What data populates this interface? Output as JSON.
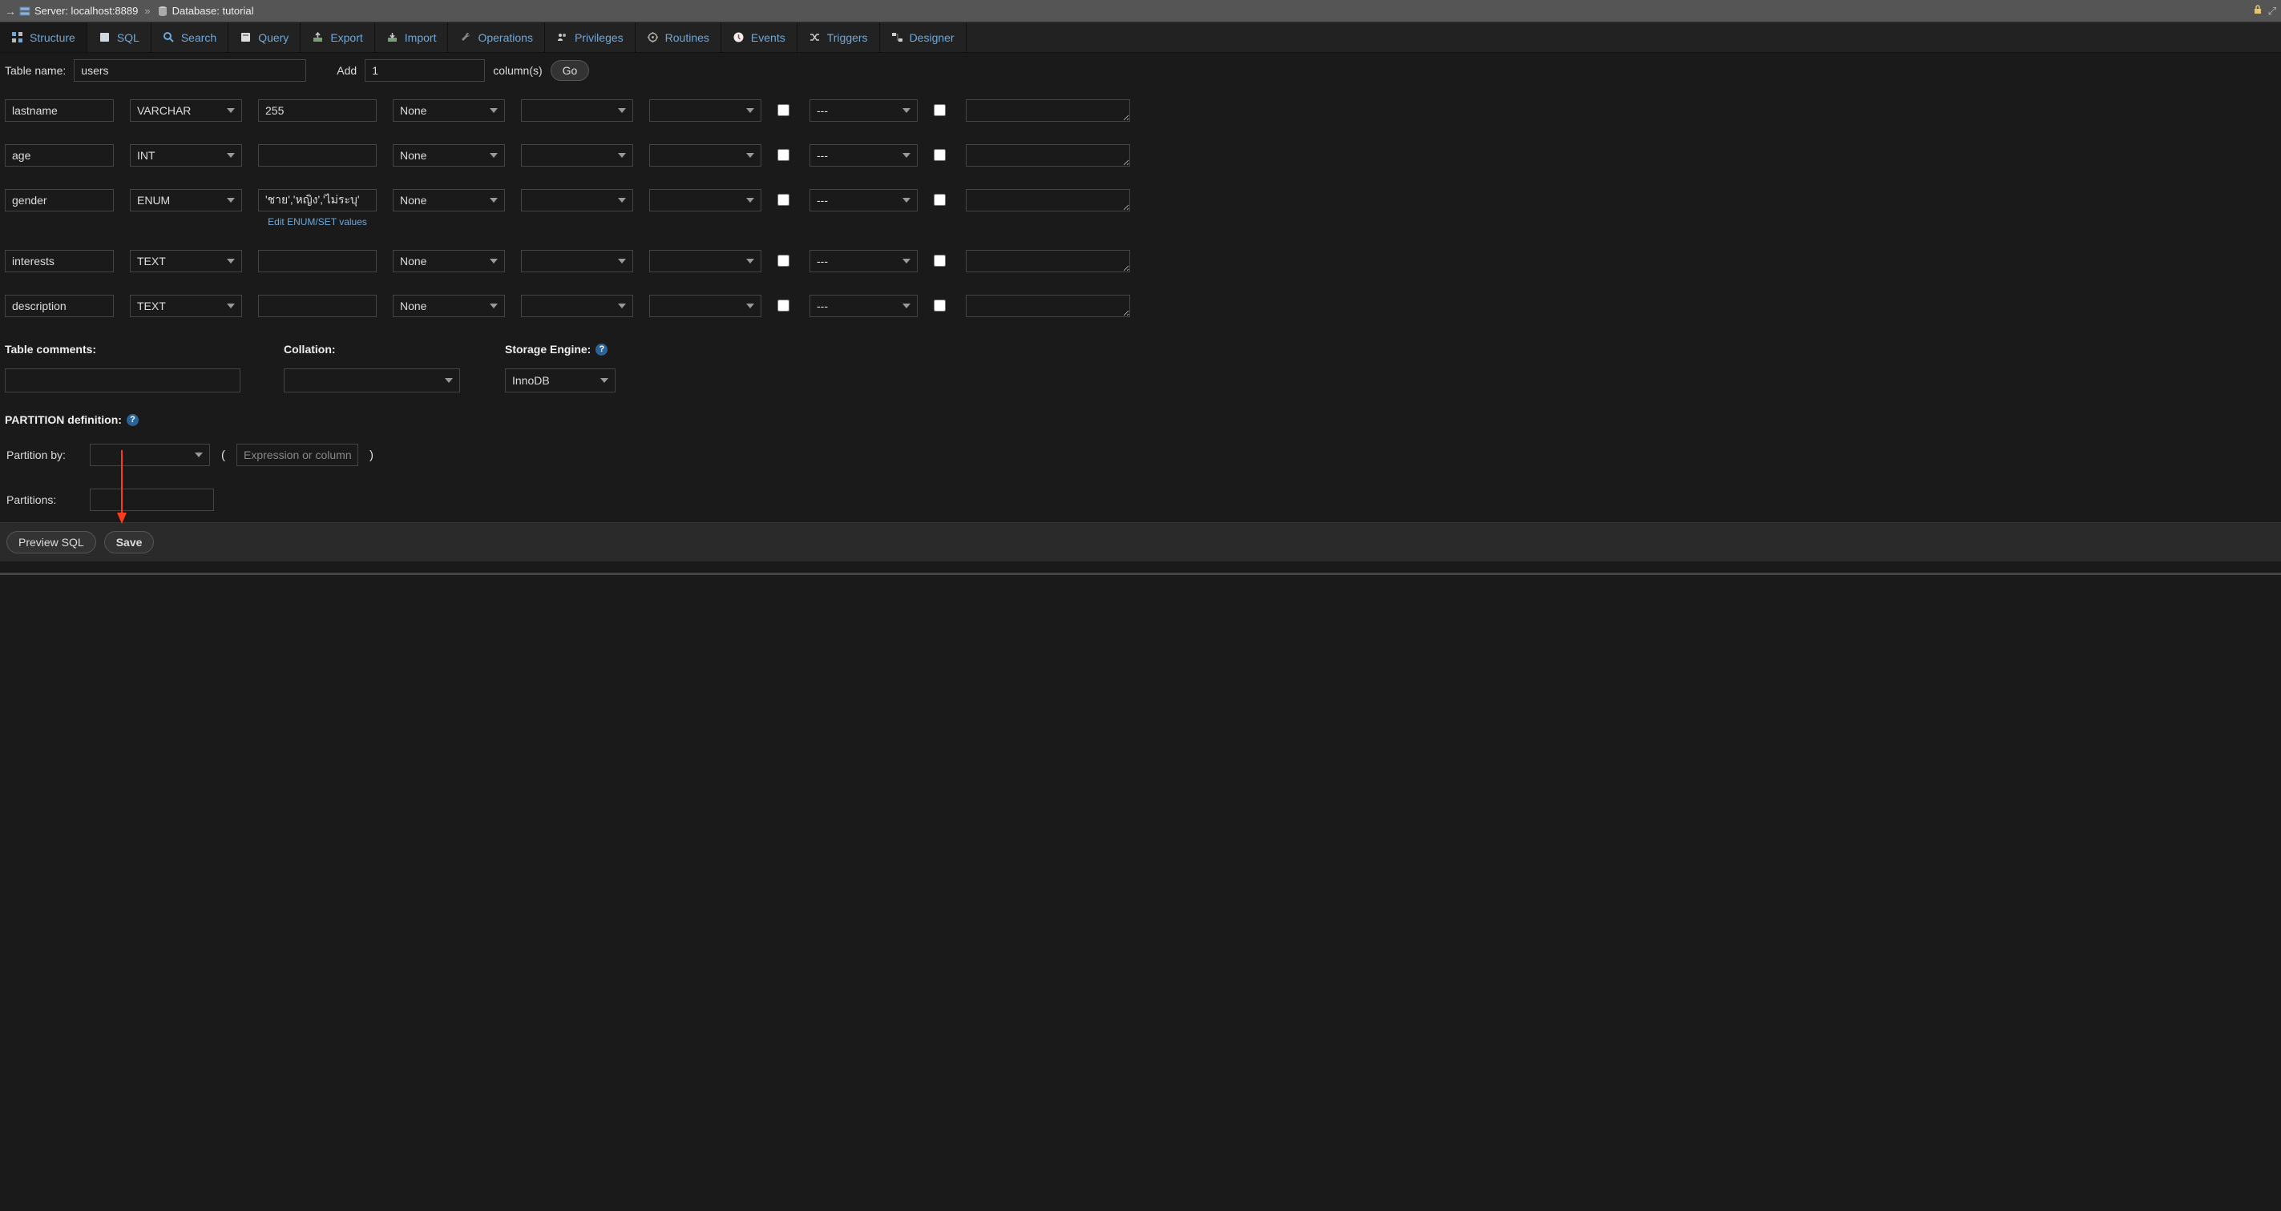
{
  "breadcrumb": {
    "server_label": "Server: localhost:8889",
    "database_label": "Database: tutorial"
  },
  "tabs": [
    {
      "id": "structure",
      "label": "Structure"
    },
    {
      "id": "sql",
      "label": "SQL"
    },
    {
      "id": "search",
      "label": "Search"
    },
    {
      "id": "query",
      "label": "Query"
    },
    {
      "id": "export",
      "label": "Export"
    },
    {
      "id": "import",
      "label": "Import"
    },
    {
      "id": "operations",
      "label": "Operations"
    },
    {
      "id": "privileges",
      "label": "Privileges"
    },
    {
      "id": "routines",
      "label": "Routines"
    },
    {
      "id": "events",
      "label": "Events"
    },
    {
      "id": "triggers",
      "label": "Triggers"
    },
    {
      "id": "designer",
      "label": "Designer"
    }
  ],
  "toolbar": {
    "table_name_label": "Table name:",
    "table_name_value": "users",
    "add_label": "Add",
    "add_value": "1",
    "columns_label": "column(s)",
    "go_label": "Go"
  },
  "index_placeholder": "---",
  "enum_link": "Edit ENUM/SET values",
  "fields": [
    {
      "name": "lastname",
      "type": "VARCHAR",
      "len": "255",
      "def": "None",
      "enum": false
    },
    {
      "name": "age",
      "type": "INT",
      "len": "",
      "def": "None",
      "enum": false
    },
    {
      "name": "gender",
      "type": "ENUM",
      "len": "'ชาย','หญิง','ไม่ระบุ'",
      "def": "None",
      "enum": true
    },
    {
      "name": "interests",
      "type": "TEXT",
      "len": "",
      "def": "None",
      "enum": false
    },
    {
      "name": "description",
      "type": "TEXT",
      "len": "",
      "def": "None",
      "enum": false
    }
  ],
  "lower": {
    "comments_label": "Table comments:",
    "collation_label": "Collation:",
    "engine_label": "Storage Engine:",
    "engine_value": "InnoDB"
  },
  "partition": {
    "title": "PARTITION definition:",
    "by_label": "Partition by:",
    "expr_placeholder": "Expression or column li",
    "partitions_label": "Partitions:"
  },
  "footer": {
    "preview": "Preview SQL",
    "save": "Save"
  }
}
